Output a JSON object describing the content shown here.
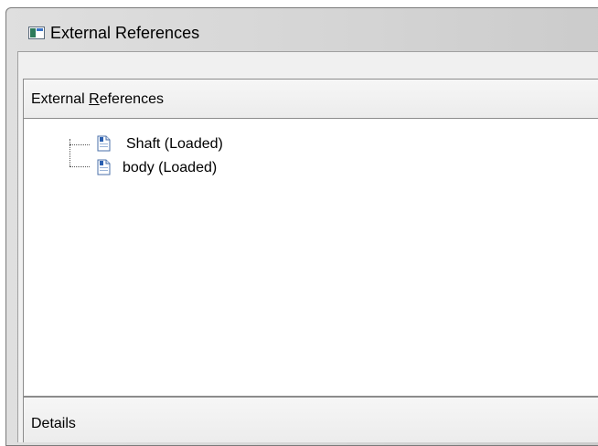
{
  "window": {
    "title": "External References"
  },
  "panel": {
    "header_prefix": "External ",
    "header_accel": "R",
    "header_suffix": "eferences",
    "details_label": "Details"
  },
  "tree": {
    "items": [
      {
        "label": "Shaft (Loaded)",
        "icon": "xref-dwg-icon"
      },
      {
        "label": "body (Loaded)",
        "icon": "xref-dwg-icon"
      }
    ]
  }
}
